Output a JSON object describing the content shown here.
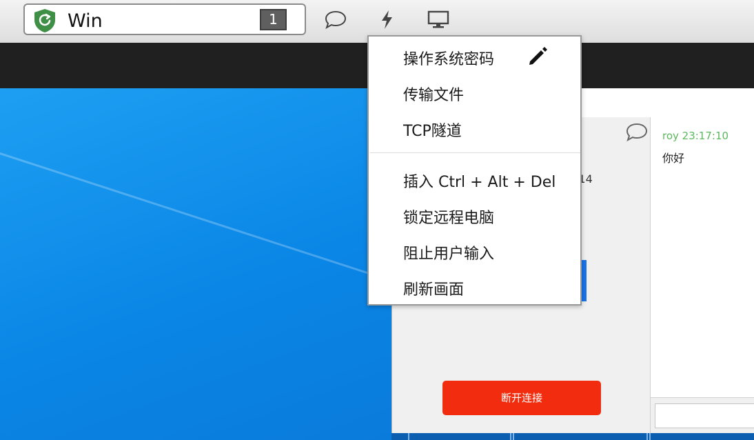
{
  "tab": {
    "title": "Win",
    "badge": "1"
  },
  "toolbar": {
    "icons": [
      "chat-icon",
      "lightning-icon",
      "monitor-icon"
    ]
  },
  "menu": {
    "items": [
      {
        "label": "操作系统密码",
        "has_edit_icon": true
      },
      {
        "label": "传输文件"
      },
      {
        "label": "TCP隧道"
      },
      {
        "label": "插入 Ctrl + Alt + Del"
      },
      {
        "label": "锁定远程电脑"
      },
      {
        "label": "阻止用户输入"
      },
      {
        "label": "刷新画面"
      }
    ]
  },
  "panel": {
    "time_fragment": ":14",
    "disconnect_label": "断开连接",
    "chat": {
      "sender": "roy 23:17:10",
      "message": "你好",
      "input_value": ""
    }
  },
  "colors": {
    "accent_green": "#3f8f46",
    "disconnect_red": "#f22d0f",
    "chat_sender_green": "#5cb85c",
    "desktop_blue": "#0a86e6"
  }
}
